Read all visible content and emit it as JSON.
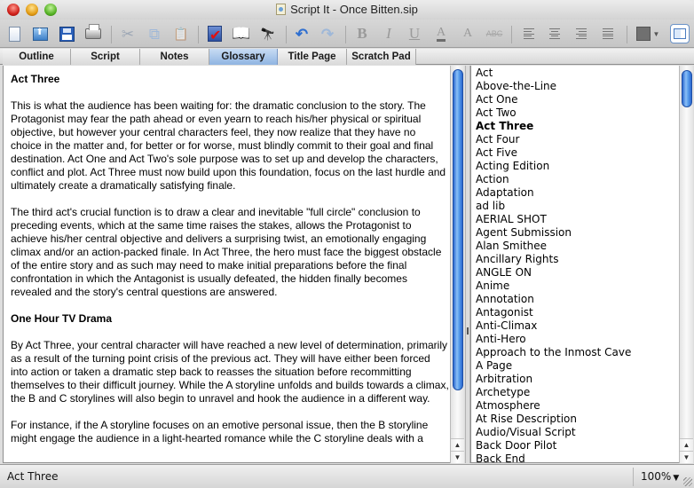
{
  "window": {
    "title": "Script It - Once Bitten.sip"
  },
  "toolbar": {
    "buttons": [
      {
        "name": "new-document",
        "label": "New"
      },
      {
        "name": "open",
        "label": "Open"
      },
      {
        "name": "save",
        "label": "Save"
      },
      {
        "name": "print",
        "label": "Print"
      },
      {
        "name": "cut",
        "label": "Cut",
        "glyph": "✂"
      },
      {
        "name": "copy",
        "label": "Copy",
        "glyph": "⧉"
      },
      {
        "name": "paste",
        "label": "Paste",
        "glyph": "📋"
      },
      {
        "name": "spell-check",
        "label": "Spell Check"
      },
      {
        "name": "book",
        "label": "Glossary Book",
        "glyph": "📖"
      },
      {
        "name": "find",
        "label": "Find",
        "glyph": "🔭"
      },
      {
        "name": "undo",
        "label": "Undo",
        "glyph": "↶"
      },
      {
        "name": "redo",
        "label": "Redo",
        "glyph": "↷"
      },
      {
        "name": "bold",
        "label": "B"
      },
      {
        "name": "italic",
        "label": "I"
      },
      {
        "name": "underline",
        "label": "U"
      },
      {
        "name": "text-color",
        "label": "A"
      },
      {
        "name": "font-size",
        "label": "A"
      },
      {
        "name": "strikethrough",
        "label": "ABC"
      },
      {
        "name": "align-left",
        "label": "Align Left"
      },
      {
        "name": "align-center",
        "label": "Align Center"
      },
      {
        "name": "align-right",
        "label": "Align Right"
      },
      {
        "name": "justify",
        "label": "Justify"
      },
      {
        "name": "color-swatch",
        "label": "Color",
        "value": "#707070"
      },
      {
        "name": "toggle-panel",
        "label": "Toggle Panel"
      }
    ]
  },
  "tabs": [
    {
      "label": "Outline",
      "active": false
    },
    {
      "label": "Script",
      "active": false
    },
    {
      "label": "Notes",
      "active": false
    },
    {
      "label": "Glossary",
      "active": true
    },
    {
      "label": "Title Page",
      "active": false
    },
    {
      "label": "Scratch Pad",
      "active": false
    }
  ],
  "document": {
    "heading1": "Act Three",
    "p1": "This is what the audience has been waiting for: the dramatic conclusion to the story.  The Protagonist may fear the path ahead or even yearn to reach his/her physical or spiritual objective, but however your central characters feel, they now realize that they have no choice in the matter and, for better or for worse, must blindly commit to their goal and final destination.  Act One and Act Two's sole purpose was to set up and develop the characters, conflict and plot.  Act Three must now build upon this foundation, focus on the last hurdle and ultimately create a dramatically satisfying finale.",
    "p2": "The third act's crucial function is to draw a clear and inevitable \"full circle\" conclusion to preceding events, which at the same time raises the stakes, allows the Protagonist to achieve his/her central objective and delivers a surprising twist, an emotionally engaging climax and/or an action-packed finale.  In Act Three, the hero must face the biggest obstacle of the entire story and as such may need to make initial preparations before the final confrontation in which the Antagonist is usually defeated, the hidden finally becomes revealed and the story's central questions are answered.",
    "heading2": "One Hour TV Drama",
    "p3": "By Act Three, your central character will have reached a new level of determination, primarily as a result of the turning point crisis of the previous act. They will have either been forced into action or taken a dramatic step back to reasses the situation before recommitting themselves to their difficult journey.  While the A storyline unfolds and builds towards a climax, the B and C storylines will also begin to unravel and hook the audience in a different way.",
    "p4": "For instance, if the A storyline focuses on an emotive  personal issue, then the B storyline might engage the audience in a light-hearted romance while the C storyline deals with a"
  },
  "glossary": {
    "selected": "Act Three",
    "items": [
      "Act",
      "Above-the-Line",
      "Act One",
      "Act Two",
      "Act Three",
      "Act Four",
      "Act Five",
      "Acting Edition",
      "Action",
      "Adaptation",
      "ad lib",
      "AERIAL SHOT",
      "Agent Submission",
      "Alan Smithee",
      "Ancillary Rights",
      "ANGLE ON",
      "Anime",
      "Annotation",
      "Antagonist",
      "Anti-Climax",
      "Anti-Hero",
      "Approach to the Inmost Cave",
      "A Page",
      "Arbitration",
      "Archetype",
      "Atmosphere",
      "At Rise Description",
      "Audio/Visual Script",
      "Back Door Pilot",
      "Back End"
    ]
  },
  "scroll": {
    "up_arrow": "▲",
    "down_arrow": "▼"
  },
  "statusbar": {
    "current_term": "Act Three",
    "zoom": "100%",
    "zoom_caret": "▼"
  }
}
